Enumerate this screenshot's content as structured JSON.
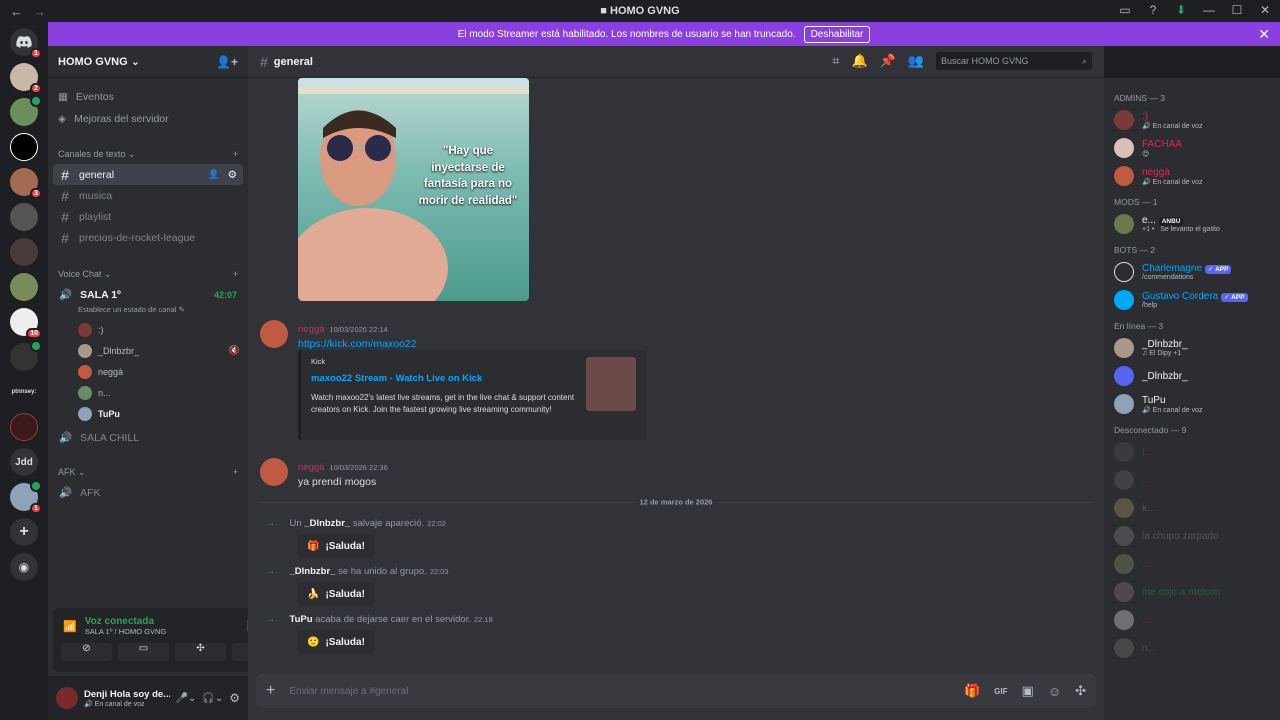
{
  "titlebar": {
    "title": "HOMO GVNG",
    "back": "←",
    "forward": "→"
  },
  "banner": {
    "text": "El modo Streamer está habilitado. Los nombres de usuario se han truncado.",
    "button": "Deshabilitar"
  },
  "guilds": [
    {
      "name": "discord-home",
      "badge": "1"
    },
    {
      "name": "server-1",
      "badge": "2"
    },
    {
      "name": "server-2",
      "badge": ""
    },
    {
      "name": "server-3",
      "badge": ""
    },
    {
      "name": "server-4",
      "badge": "3"
    },
    {
      "name": "server-5",
      "badge": ""
    },
    {
      "name": "server-6",
      "badge": ""
    },
    {
      "name": "server-7",
      "badge": ""
    },
    {
      "name": "server-8",
      "badge": "10"
    },
    {
      "name": "server-9",
      "badge": ""
    },
    {
      "name": "server-text",
      "label": "ptnnsey:"
    },
    {
      "name": "server-10",
      "badge": ""
    },
    {
      "name": "server-jdd",
      "label": "Jdd"
    },
    {
      "name": "server-homo-gvng",
      "badge": "1"
    }
  ],
  "sidebar": {
    "server_name": "HOMO GVNG",
    "events": "Eventos",
    "boosts": "Mejoras del servidor",
    "text_category": "Canales de texto",
    "text_channels": [
      "general",
      "musica",
      "playlist",
      "precios-de-rocket-league"
    ],
    "voice_category": "Voice Chat",
    "voice_channel_1": "SALA 1º",
    "voice_timer": "42:07",
    "voice_status": "Establece un estado de canal",
    "voice_users": [
      ":)",
      "_Dlnbzbr_",
      "neggá",
      "n...",
      "TuPu"
    ],
    "voice_channel_2": "SALA CHILL",
    "afk_category": "AFK",
    "afk_channel": "AFK"
  },
  "voice_panel": {
    "status": "Voz conectada",
    "location": "SALA 1º / HOMO GVNG"
  },
  "user_panel": {
    "name": "Denji Hola soy de...",
    "status": "En canal de voz"
  },
  "chat": {
    "channel": "general",
    "search_placeholder": "Buscar HOMO GVNG",
    "image_caption": "\"Hay que inyectarse de fantasía para no morir de realidad\"",
    "messages": [
      {
        "author": "neggá",
        "timestamp": "10/03/2026 22:14",
        "link": "https://kick.com/maxoo22",
        "embed": {
          "provider": "Kick",
          "title": "maxoo22 Stream - Watch Live on Kick",
          "description": "Watch maxoo22's latest live streams, get in the live chat & support content creators on Kick. Join the fastest growing live streaming community!"
        }
      },
      {
        "author": "neggá",
        "timestamp": "10/03/2026 22:36",
        "text": "ya prendí mogos"
      }
    ],
    "date_divider": "12 de marzo de 2026",
    "system": [
      {
        "prefix": "Un ",
        "user": "_Dlnbzbr_",
        "suffix": " salvaje apareció.",
        "time": "22:02",
        "wave": "¡Saluda!"
      },
      {
        "prefix": "",
        "user": "_Dlnbzbr_",
        "suffix": " se ha unido al grupo.",
        "time": "22:03",
        "wave": "¡Saluda!"
      },
      {
        "prefix": "",
        "user": "TuPu",
        "suffix": " acaba de dejarse caer en el servidor.",
        "time": "22:18",
        "wave": "¡Saluda!"
      }
    ],
    "composer_placeholder": "Enviar mensaje a #general"
  },
  "members": {
    "admins_header": "ADMINS — 3",
    "admins": [
      {
        "name": ":)",
        "status": "En canal de voz",
        "color": "#e0245e"
      },
      {
        "name": "FACHAA",
        "status": "😊",
        "color": "#e0245e"
      },
      {
        "name": "neggá",
        "status": "En canal de voz",
        "color": "#e0245e"
      }
    ],
    "mods_header": "MODS — 1",
    "mods": [
      {
        "name": "e...",
        "tag": "ANBU",
        "status": "Se levanto el gatito",
        "extra": "+1 •"
      }
    ],
    "bots_header": "BOTS — 2",
    "bots": [
      {
        "name": "Charlemagne",
        "tag": "APP",
        "status": "/commendations"
      },
      {
        "name": "Gustavo Cordera",
        "tag": "APP",
        "status": "/help"
      }
    ],
    "online_header": "En línea — 3",
    "online": [
      {
        "name": "_Dlnbzbr_",
        "status": "El Dipy +1"
      },
      {
        "name": "_Dlnbzbr_",
        "status": ""
      },
      {
        "name": "TuPu",
        "status": "En canal de voz"
      }
    ],
    "offline_header": "Desconectado — 9",
    "offline": [
      {
        "name": "f...",
        "color": "#e0245e"
      },
      {
        "name": "...",
        "color": "#e0245e"
      },
      {
        "name": "k...",
        "color": "#949ba4"
      },
      {
        "name": "la chupo zarpado",
        "color": "#949ba4"
      },
      {
        "name": "...",
        "color": "#e0245e"
      },
      {
        "name": "me cojo a melcon",
        "color": "#3ba55d"
      },
      {
        "name": "...",
        "color": "#e0245e"
      },
      {
        "name": "n...",
        "color": "#949ba4"
      }
    ]
  },
  "colors": {
    "accent": "#5865f2",
    "banner": "#8b3fe0",
    "online": "#23a55a",
    "admin": "#e0245e",
    "bot": "#00a8fc"
  }
}
